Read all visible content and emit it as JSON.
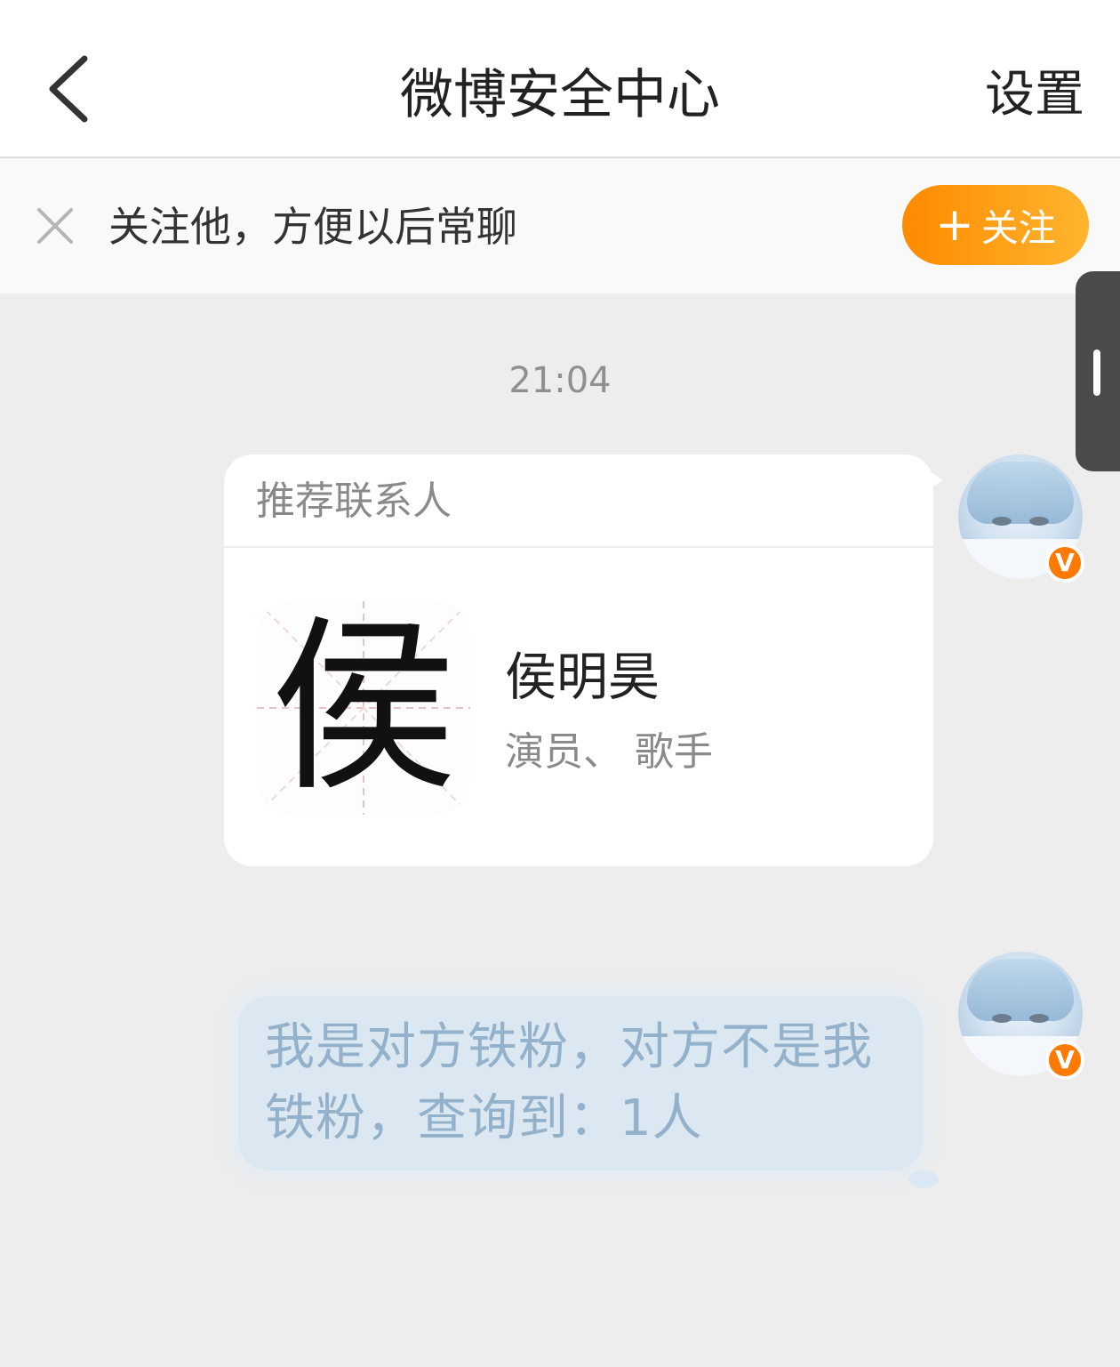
{
  "nav": {
    "title": "微博安全中心",
    "settings_label": "设置",
    "back_icon": "chevron-left-icon"
  },
  "follow_bar": {
    "text": "关注他，方便以后常聊",
    "button_label": "关注",
    "button_plus": "+",
    "close_icon": "close-icon",
    "button_color_start": "#ff8a00",
    "button_color_end": "#ffb52f"
  },
  "chat": {
    "timestamp": "21:04",
    "card": {
      "header": "推荐联系人",
      "avatar_glyph": "侯",
      "contact_name": "侯明昊",
      "contact_desc": "演员、 歌手"
    },
    "message": {
      "text": "我是对方铁粉，对方不是我铁粉，查询到：1人"
    },
    "sender_badge": "V",
    "badge_color": "#ff7a00"
  }
}
